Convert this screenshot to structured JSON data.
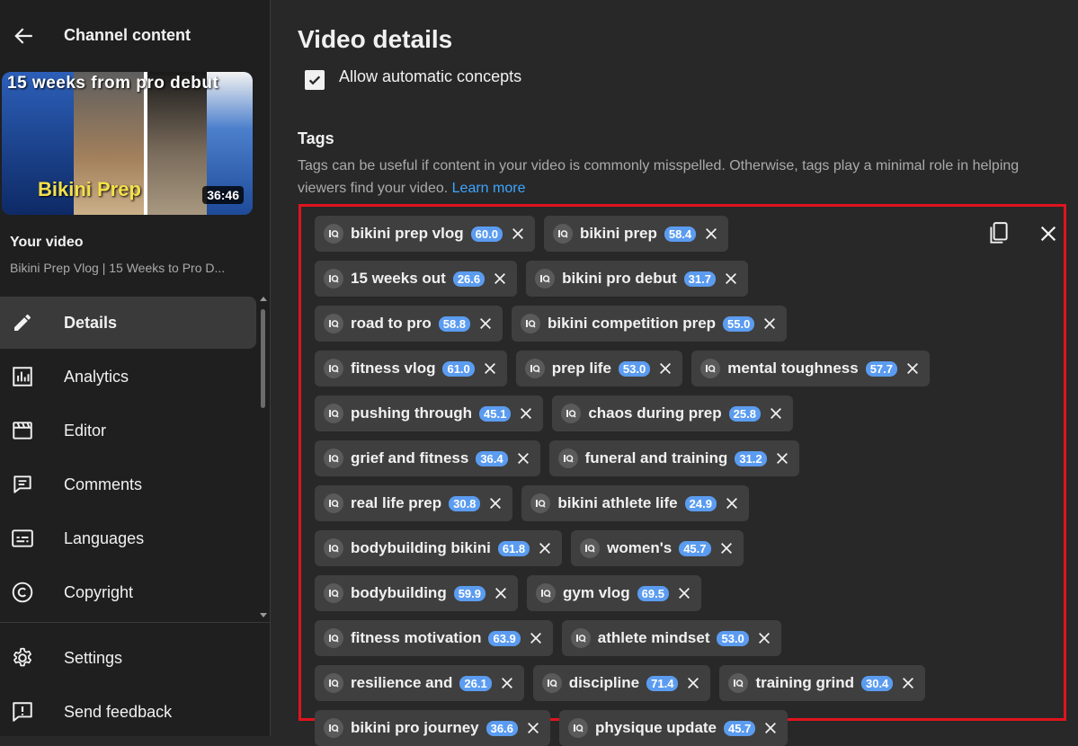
{
  "sidebar": {
    "back_label": "",
    "title": "Channel content",
    "thumbnail": {
      "overlay_text": "15  weeks  from pro  debut",
      "title_text": "Bikini Prep",
      "duration": "36:46"
    },
    "your_video_label": "Your video",
    "video_title": "Bikini Prep Vlog | 15 Weeks to Pro D...",
    "nav": [
      {
        "label": "Details",
        "icon": "pencil-icon",
        "active": true
      },
      {
        "label": "Analytics",
        "icon": "analytics-icon",
        "active": false
      },
      {
        "label": "Editor",
        "icon": "editor-icon",
        "active": false
      },
      {
        "label": "Comments",
        "icon": "comments-icon",
        "active": false
      },
      {
        "label": "Languages",
        "icon": "languages-icon",
        "active": false
      },
      {
        "label": "Copyright",
        "icon": "copyright-icon",
        "active": false
      },
      {
        "label": "Settings",
        "icon": "gear-icon",
        "active": false
      },
      {
        "label": "Send feedback",
        "icon": "feedback-icon",
        "active": false
      }
    ]
  },
  "main": {
    "page_title": "Video details",
    "checkbox_label": "Allow automatic concepts",
    "tags_heading": "Tags",
    "tags_description": "Tags can be useful if content in your video is commonly misspelled. Otherwise, tags play a minimal role in helping viewers find your video.",
    "learn_more": "Learn more",
    "tag_rows": [
      [
        {
          "label": "bikini prep vlog",
          "score": "60.0"
        },
        {
          "label": "bikini prep",
          "score": "58.4"
        }
      ],
      [
        {
          "label": "15 weeks out",
          "score": "26.6"
        },
        {
          "label": "bikini pro debut",
          "score": "31.7"
        }
      ],
      [
        {
          "label": "road to pro",
          "score": "58.8"
        },
        {
          "label": "bikini competition prep",
          "score": "55.0"
        }
      ],
      [
        {
          "label": "fitness vlog",
          "score": "61.0"
        },
        {
          "label": "prep life",
          "score": "53.0"
        },
        {
          "label": "mental toughness",
          "score": "57.7"
        }
      ],
      [
        {
          "label": "pushing through",
          "score": "45.1"
        },
        {
          "label": "chaos during prep",
          "score": "25.8"
        }
      ],
      [
        {
          "label": "grief and fitness",
          "score": "36.4"
        },
        {
          "label": "funeral and training",
          "score": "31.2"
        }
      ],
      [
        {
          "label": "real life prep",
          "score": "30.8"
        },
        {
          "label": "bikini athlete life",
          "score": "24.9"
        }
      ],
      [
        {
          "label": "bodybuilding bikini",
          "score": "61.8"
        },
        {
          "label": "women's",
          "score": "45.7"
        }
      ],
      [
        {
          "label": "bodybuilding",
          "score": "59.9"
        },
        {
          "label": "gym vlog",
          "score": "69.5"
        }
      ],
      [
        {
          "label": "fitness motivation",
          "score": "63.9"
        },
        {
          "label": "athlete mindset",
          "score": "53.0"
        }
      ],
      [
        {
          "label": "resilience and",
          "score": "26.1"
        },
        {
          "label": "discipline",
          "score": "71.4"
        },
        {
          "label": "training grind",
          "score": "30.4"
        }
      ],
      [
        {
          "label": "bikini pro journey",
          "score": "36.6"
        },
        {
          "label": "physique update",
          "score": "45.7"
        }
      ]
    ],
    "colors": {
      "highlight_border": "#e0141e",
      "score_badge": "#5b9cf0",
      "chip_bg": "#3f3f3f",
      "link": "#3ea6ff"
    }
  }
}
